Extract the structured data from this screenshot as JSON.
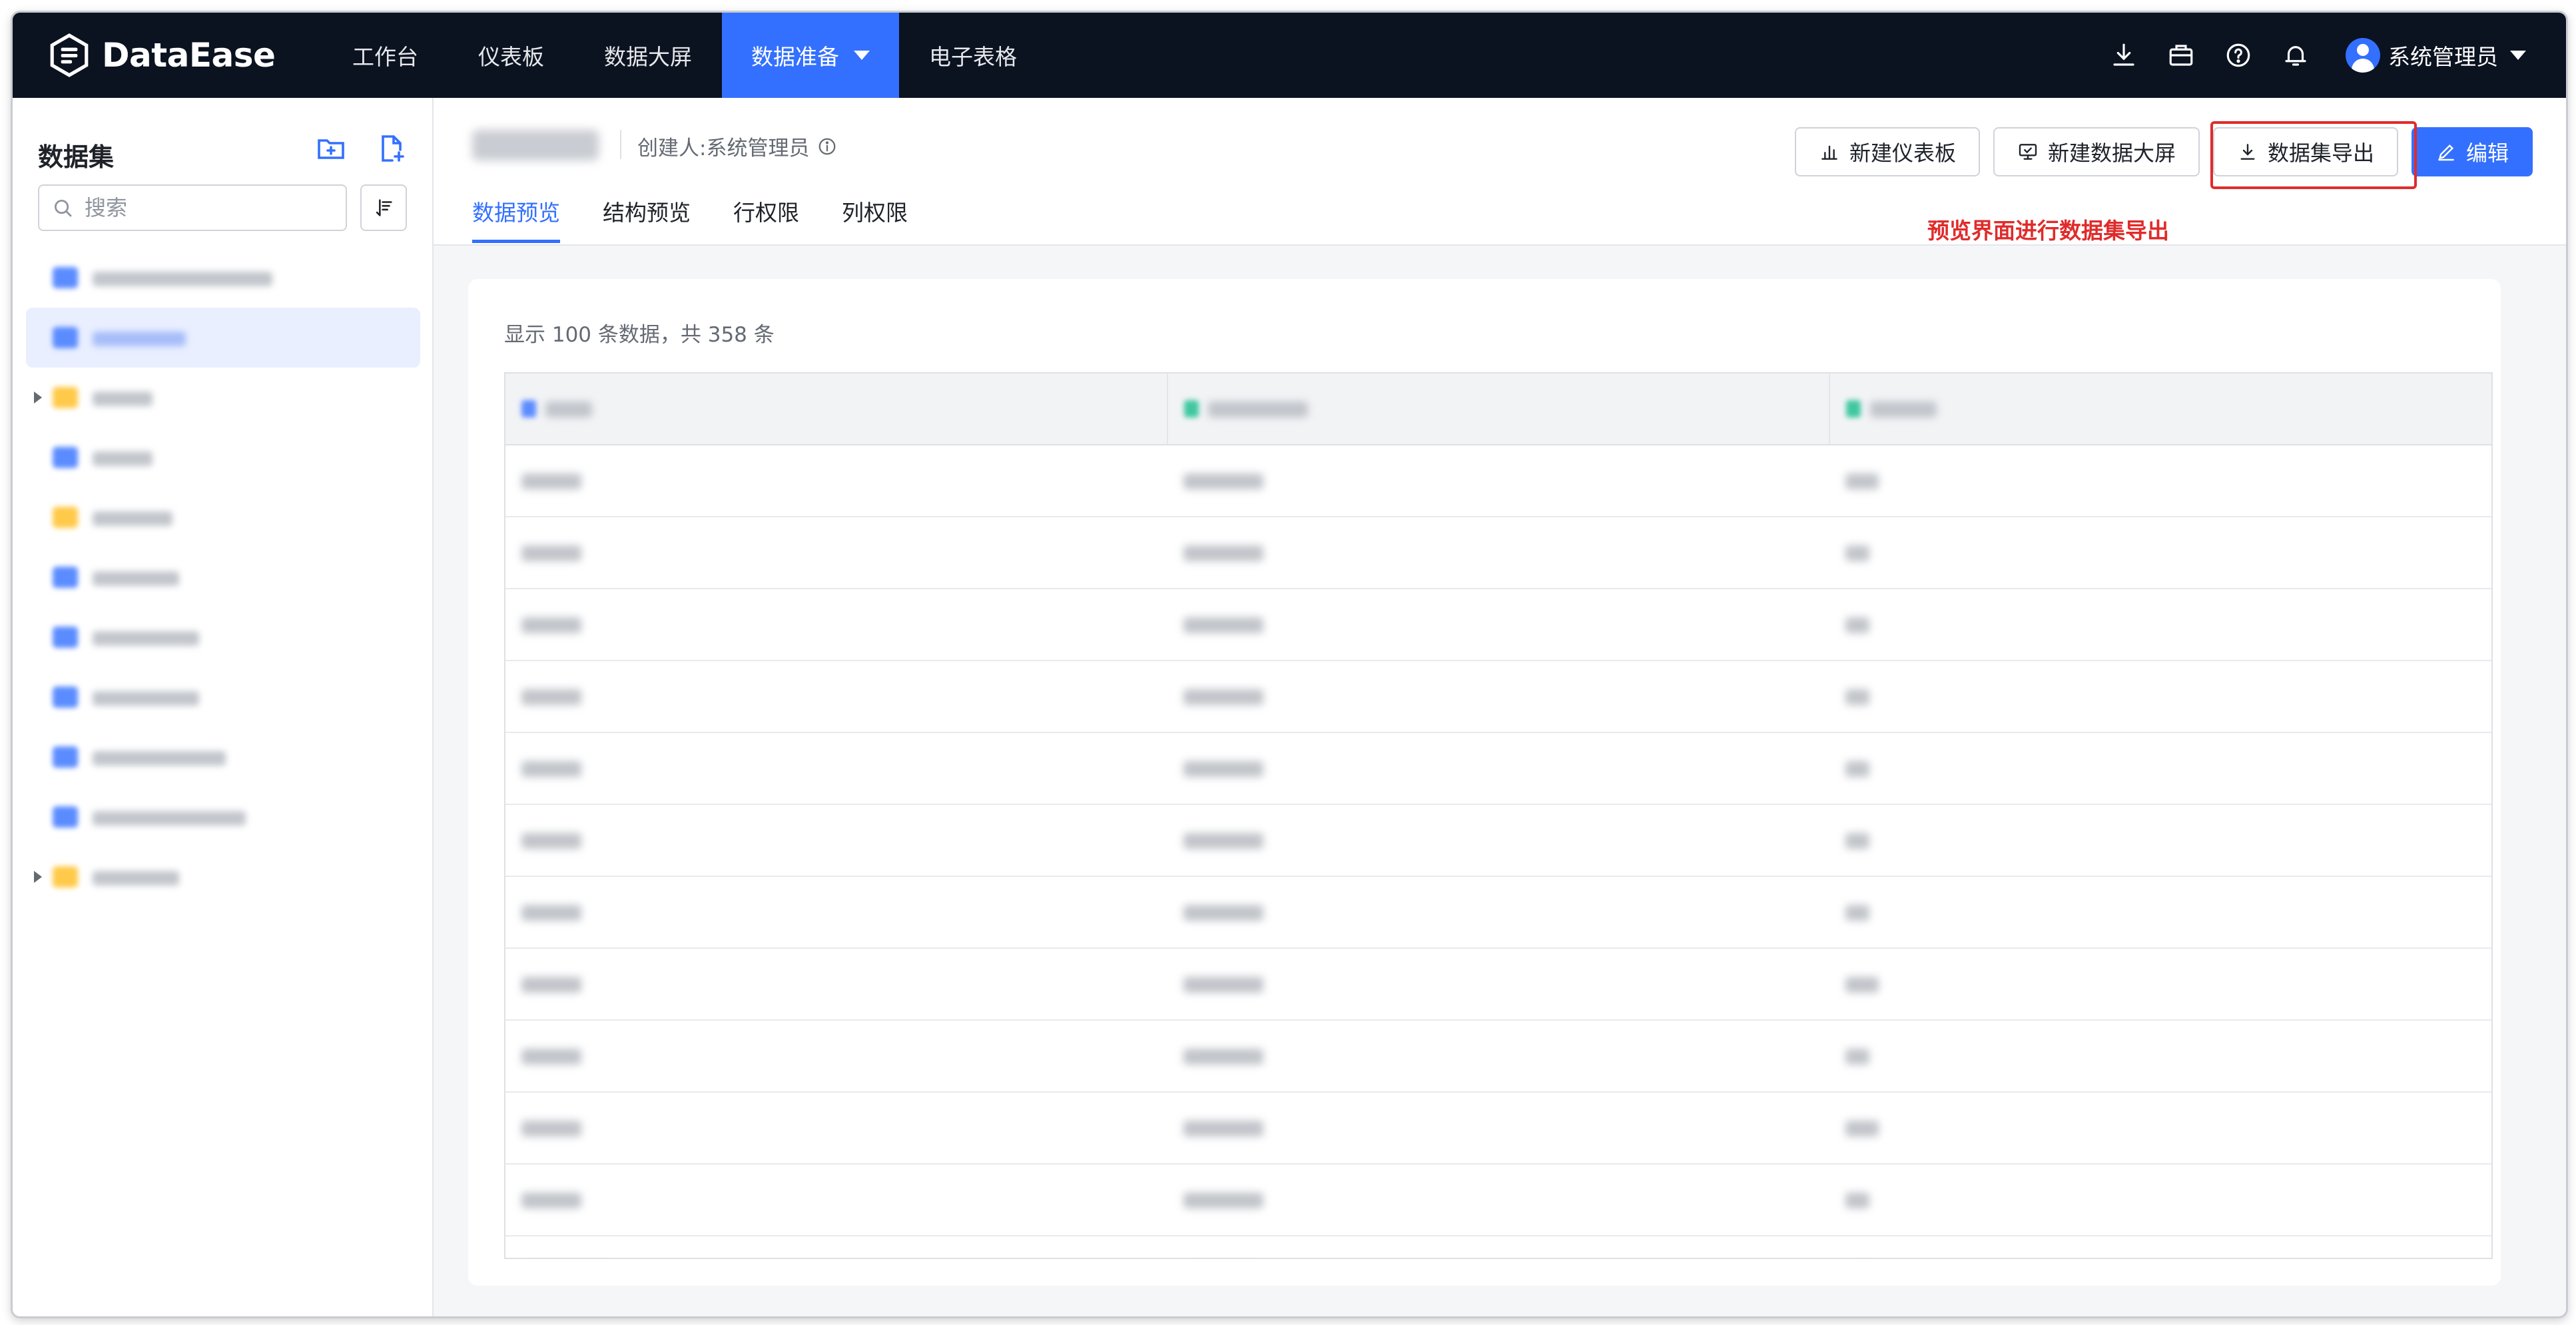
{
  "app": {
    "brand": "DataEase",
    "nav": [
      {
        "label": "工作台"
      },
      {
        "label": "仪表板"
      },
      {
        "label": "数据大屏"
      },
      {
        "label": "数据准备",
        "active": true,
        "has_dropdown": true
      },
      {
        "label": "电子表格"
      }
    ],
    "top_icons": [
      "download-icon",
      "briefcase-icon",
      "help-icon",
      "bell-icon"
    ],
    "user_name": "系统管理员"
  },
  "sidebar": {
    "title": "数据集",
    "search_placeholder": "搜索",
    "actions": [
      "new-folder-icon",
      "new-dataset-icon"
    ]
  },
  "dataset": {
    "creator_label": "创建人:系统管理员",
    "tabs": [
      {
        "label": "数据预览",
        "active": true
      },
      {
        "label": "结构预览"
      },
      {
        "label": "行权限"
      },
      {
        "label": "列权限"
      }
    ],
    "buttons": {
      "new_dashboard": "新建仪表板",
      "new_screen": "新建数据大屏",
      "export": "数据集导出",
      "edit": "编辑"
    },
    "annotation": "预览界面进行数据集导出",
    "summary": "显示 100 条数据，共 358 条"
  },
  "colors": {
    "topbar": "#0b1220",
    "accent": "#3370ff",
    "annotation_red": "#e02b2b"
  }
}
